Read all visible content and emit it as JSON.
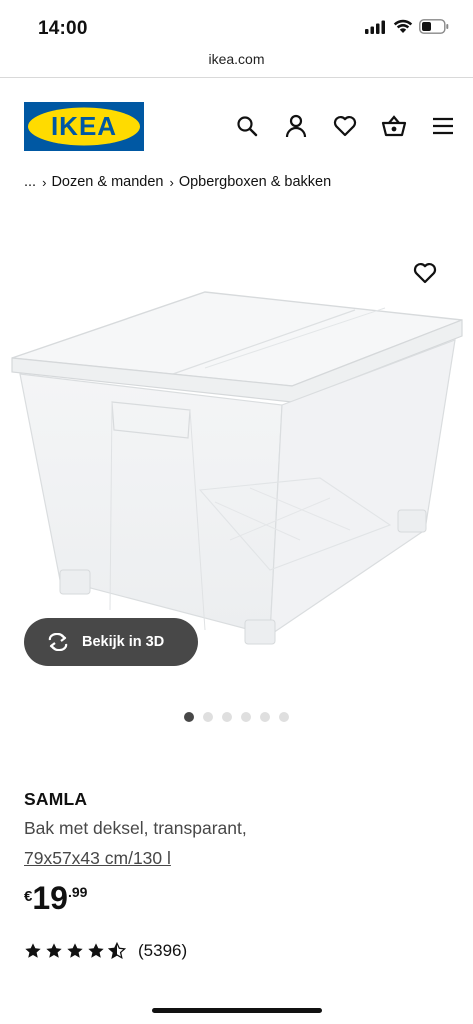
{
  "status_bar": {
    "time": "14:00",
    "icons": [
      "signal-icon",
      "wifi-icon",
      "battery-icon"
    ]
  },
  "browser": {
    "url": "ikea.com"
  },
  "header": {
    "logo_text": "IKEA",
    "brand_colors": {
      "blue": "#0058a3",
      "yellow": "#ffdb00"
    },
    "icons": [
      "search-icon",
      "account-icon",
      "heart-icon",
      "basket-icon",
      "menu-icon"
    ]
  },
  "breadcrumb": {
    "ellipsis": "...",
    "items": [
      "Dozen & manden",
      "Opbergboxen & bakken"
    ]
  },
  "media": {
    "view_3d_label": "Bekijk in 3D",
    "image_count": 6,
    "active_index": 0
  },
  "product": {
    "name": "SAMLA",
    "description": "Bak met deksel, transparant,",
    "size": "79x57x43 cm/130 l",
    "price": {
      "currency": "€",
      "integer": "19",
      "decimals": ".99"
    },
    "rating": {
      "stars": 5,
      "count": "(5396)"
    }
  }
}
